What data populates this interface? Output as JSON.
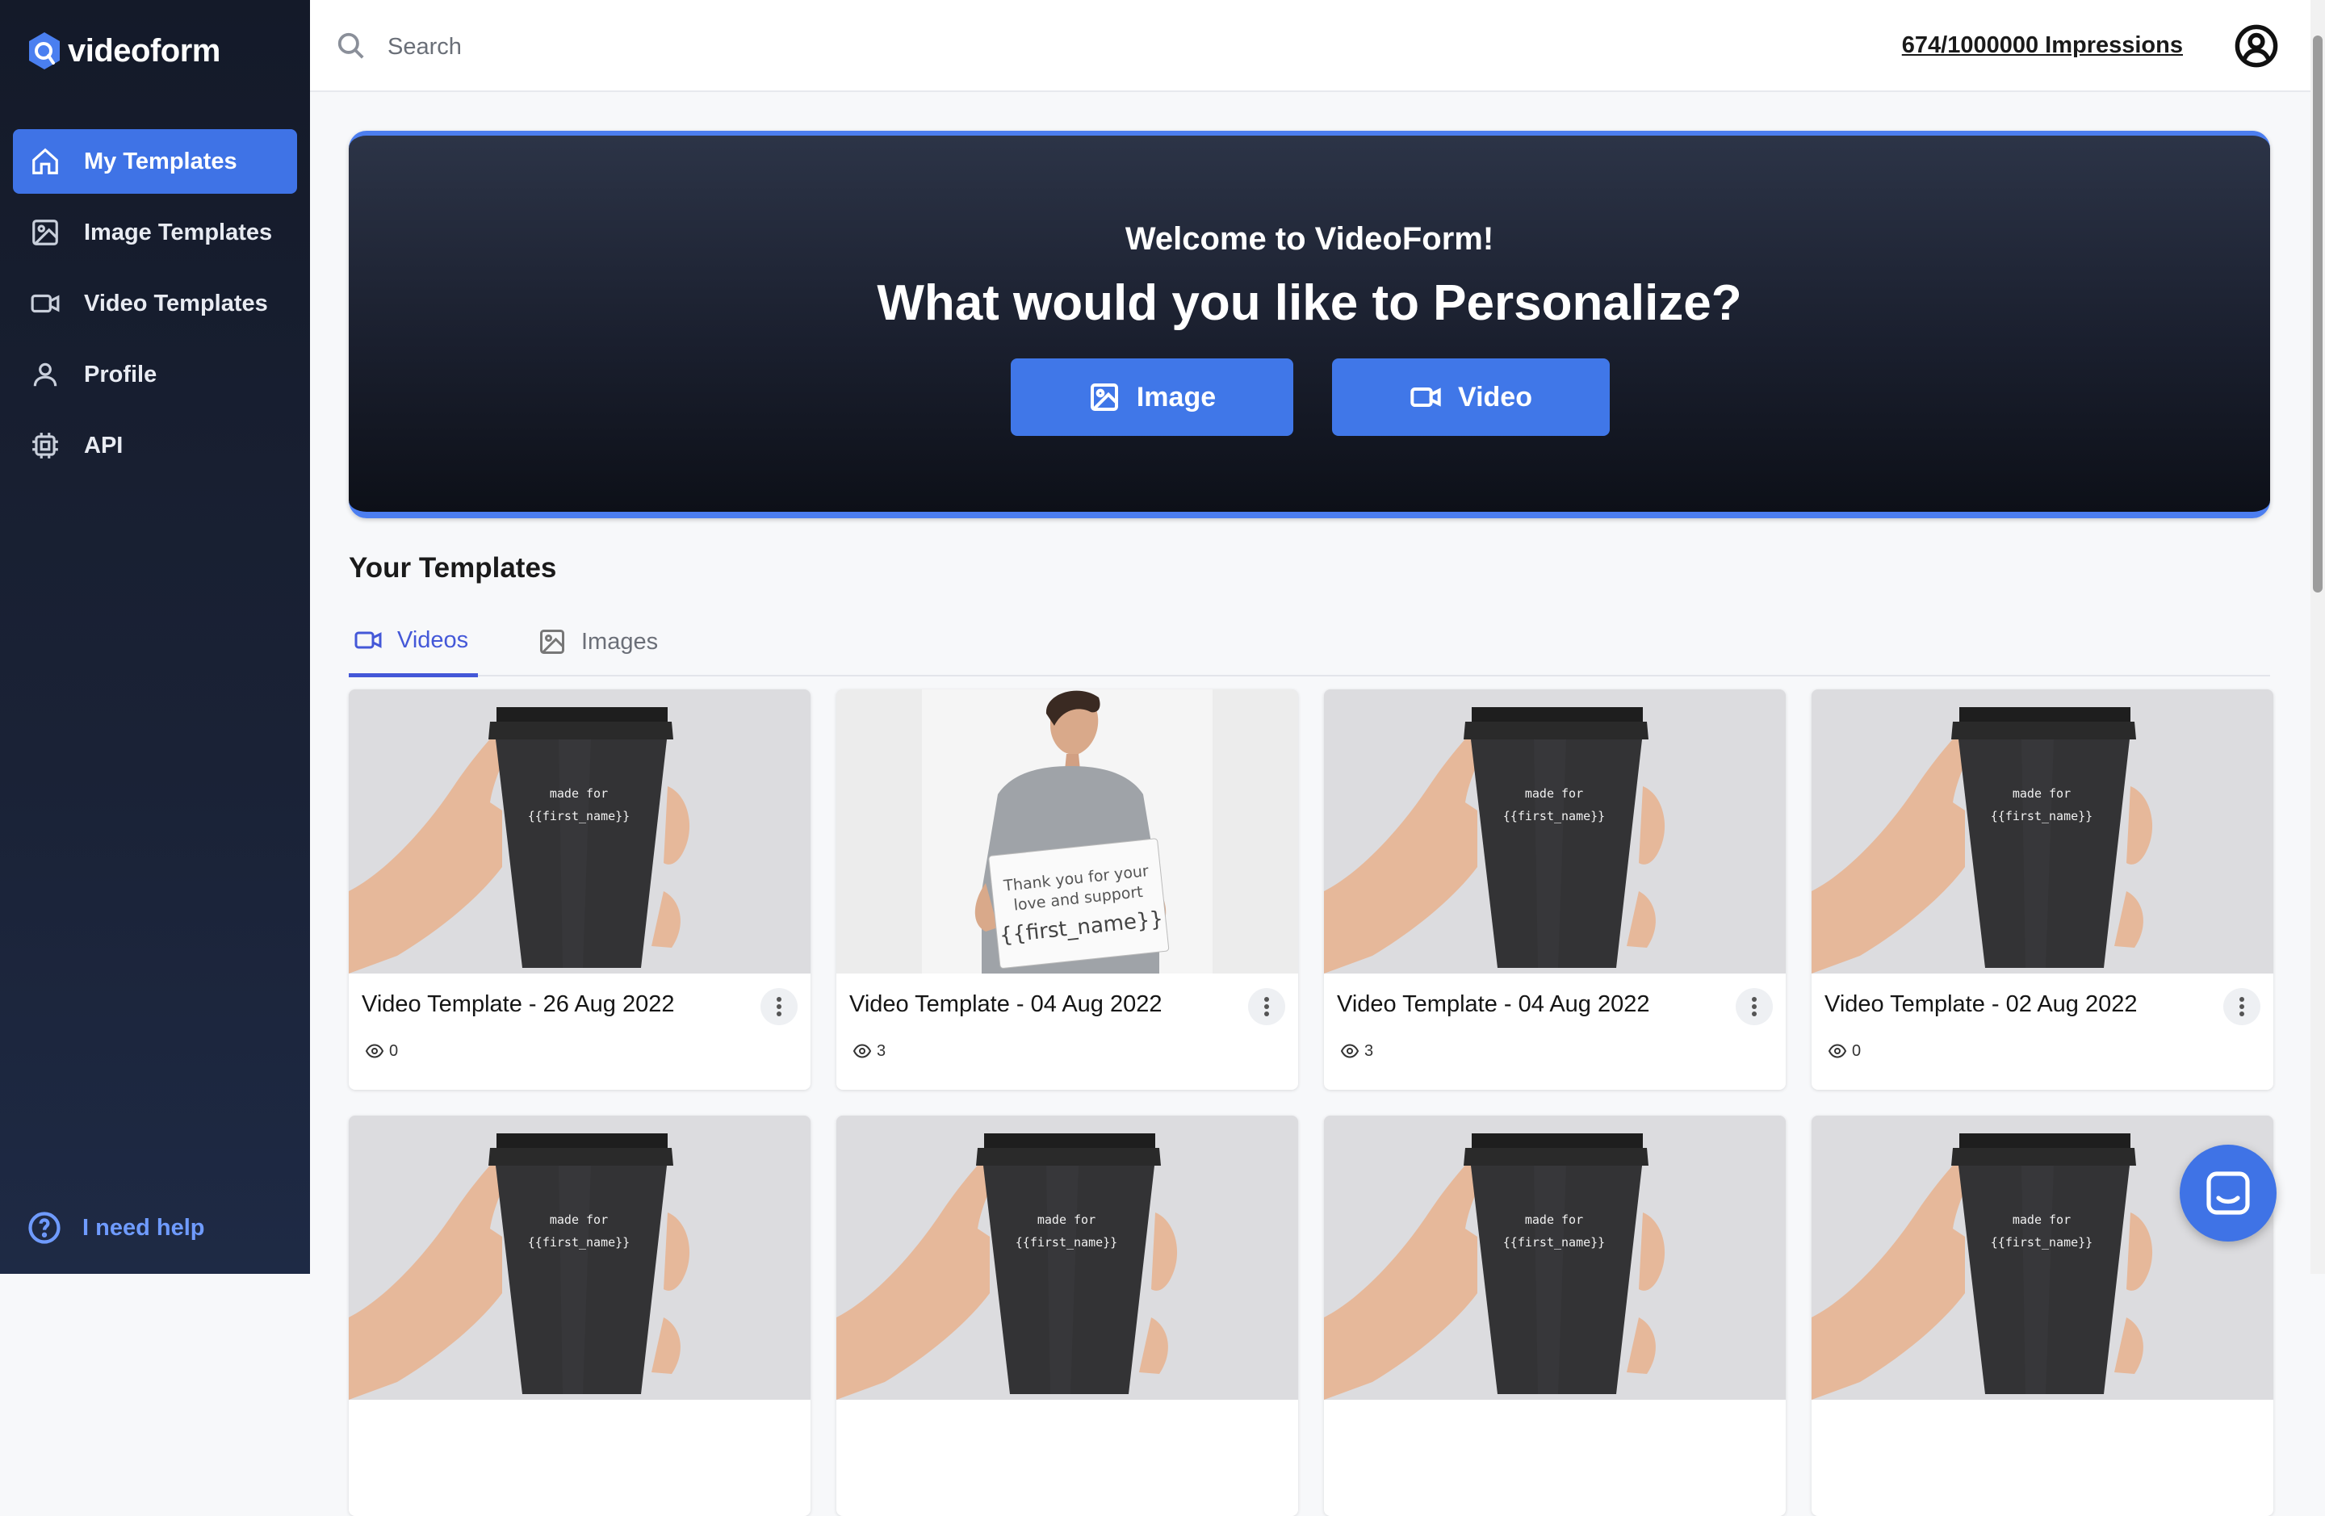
{
  "app": {
    "name": "videoform"
  },
  "sidebar": {
    "items": [
      {
        "label": "My Templates",
        "icon": "home-icon",
        "active": true
      },
      {
        "label": "Image Templates",
        "icon": "image-icon",
        "active": false
      },
      {
        "label": "Video Templates",
        "icon": "video-icon",
        "active": false
      },
      {
        "label": "Profile",
        "icon": "user-icon",
        "active": false
      },
      {
        "label": "API",
        "icon": "chip-icon",
        "active": false
      }
    ],
    "help_label": "I need help"
  },
  "topbar": {
    "search_placeholder": "Search",
    "impressions": "674/1000000 Impressions"
  },
  "hero": {
    "welcome": "Welcome to VideoForm!",
    "title": "What would you like to Personalize?",
    "image_button": "Image",
    "video_button": "Video"
  },
  "templates": {
    "section_title": "Your Templates",
    "tabs": [
      {
        "label": "Videos",
        "active": true
      },
      {
        "label": "Images",
        "active": false
      }
    ],
    "cards": [
      {
        "title": "Video Template - 26 Aug 2022",
        "views": "0",
        "thumb": "cup"
      },
      {
        "title": "Video Template - 04 Aug 2022",
        "views": "3",
        "thumb": "person"
      },
      {
        "title": "Video Template - 04 Aug 2022",
        "views": "3",
        "thumb": "cup"
      },
      {
        "title": "Video Template - 02 Aug 2022",
        "views": "0",
        "thumb": "cup"
      },
      {
        "title": "",
        "views": "",
        "thumb": "cup"
      },
      {
        "title": "",
        "views": "",
        "thumb": "cup"
      },
      {
        "title": "",
        "views": "",
        "thumb": "cup"
      },
      {
        "title": "",
        "views": "",
        "thumb": "cup"
      }
    ],
    "cup_text_line1": "made for",
    "cup_text_line2": "{{first_name}}",
    "sign_text_line1": "Thank you for your",
    "sign_text_line2": "love and support",
    "sign_text_line3": "{{first_name}}"
  },
  "colors": {
    "accent": "#3f73e6",
    "tab_active": "#4458d8",
    "sidebar_bg": "#141a29"
  }
}
